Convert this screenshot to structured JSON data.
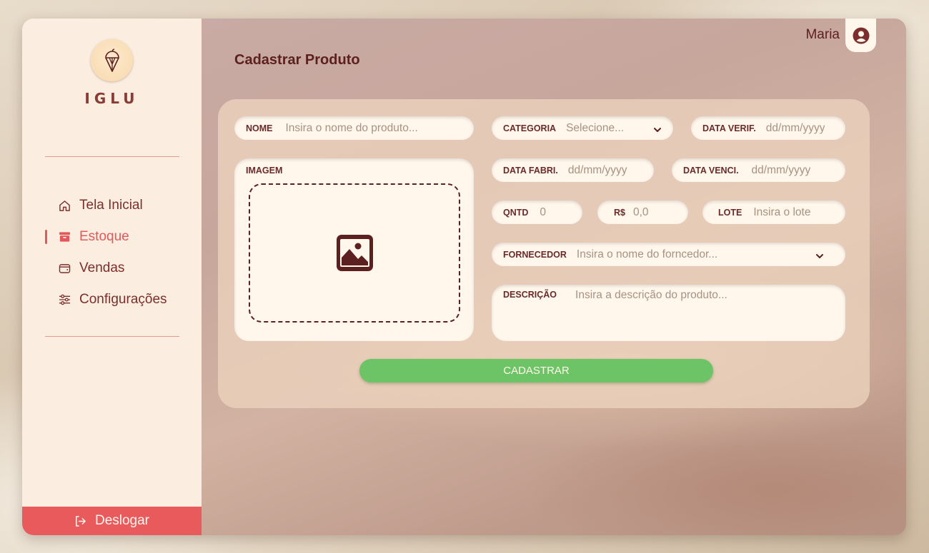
{
  "brand": {
    "name": "IGLU",
    "logo_icon": "ice-cream-icon"
  },
  "sidebar": {
    "items": [
      {
        "label": "Tela Inicial",
        "icon": "home-icon",
        "active": false
      },
      {
        "label": "Estoque",
        "icon": "archive-box-icon",
        "active": true
      },
      {
        "label": "Vendas",
        "icon": "wallet-icon",
        "active": false
      },
      {
        "label": "Configurações",
        "icon": "sliders-icon",
        "active": false
      }
    ],
    "logout_label": "Deslogar"
  },
  "header": {
    "user_name": "Maria",
    "user_icon": "user-circle-icon"
  },
  "page": {
    "title": "Cadastrar Produto"
  },
  "form": {
    "nome": {
      "label": "NOME",
      "placeholder": "Insira o nome do produto..."
    },
    "categoria": {
      "label": "CATEGORIA",
      "placeholder": "Selecione..."
    },
    "data_verif": {
      "label": "DATA VERIF.",
      "placeholder": "dd/mm/yyyy"
    },
    "imagem": {
      "label": "IMAGEM"
    },
    "data_fabri": {
      "label": "DATA FABRI.",
      "placeholder": "dd/mm/yyyy"
    },
    "data_venci": {
      "label": "DATA VENCI.",
      "placeholder": "dd/mm/yyyy"
    },
    "qntd": {
      "label": "QNTD",
      "placeholder": "0"
    },
    "preco": {
      "label": "R$",
      "placeholder": "0,0"
    },
    "lote": {
      "label": "LOTE",
      "placeholder": "Insira o lote"
    },
    "fornecedor": {
      "label": "FORNECEDOR",
      "placeholder": "Insira o nome do forncedor..."
    },
    "descricao": {
      "label": "DESCRIÇÃO",
      "placeholder": "Insira a descrição do produto..."
    },
    "submit_label": "CADASTRAR"
  },
  "colors": {
    "accent_red": "#e85a5c",
    "dark_brown": "#5c2020",
    "submit_green": "#6dc466",
    "sidebar_bg": "#fbeee0",
    "field_bg": "#fff6ec"
  }
}
